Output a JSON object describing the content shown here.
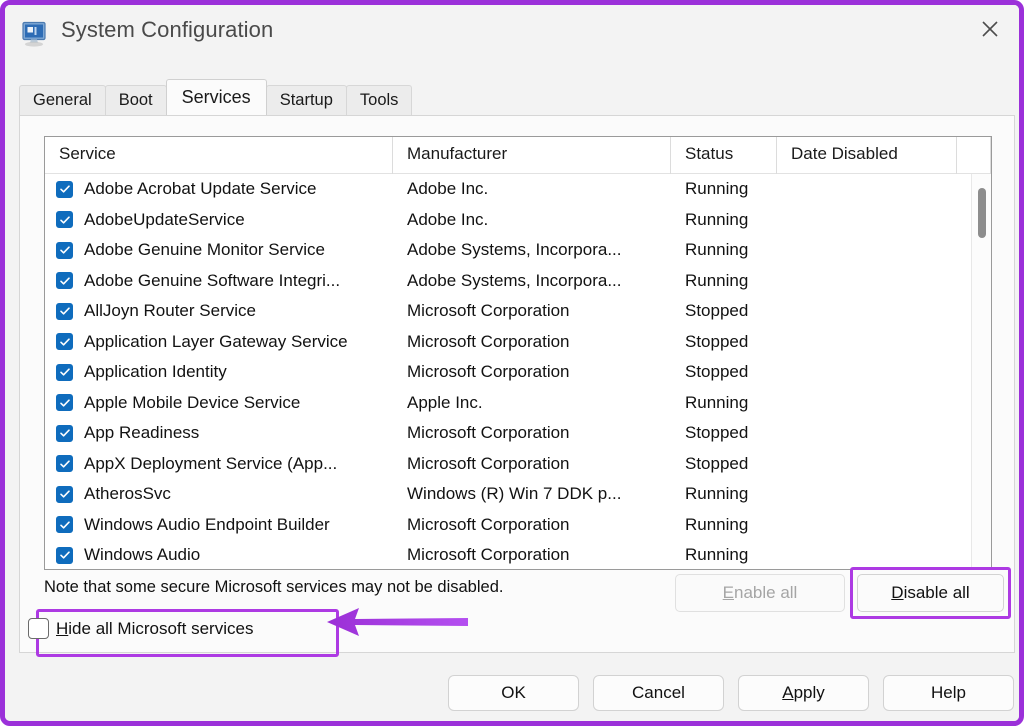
{
  "window": {
    "title": "System Configuration",
    "icon": "system-configuration-icon",
    "close_label": "✕",
    "accent_purple": "#ad3ae3",
    "border_purple": "#9b30d9"
  },
  "tabs": [
    {
      "label": "General",
      "active": false
    },
    {
      "label": "Boot",
      "active": false
    },
    {
      "label": "Services",
      "active": true
    },
    {
      "label": "Startup",
      "active": false
    },
    {
      "label": "Tools",
      "active": false
    }
  ],
  "services_table": {
    "columns": [
      "Service",
      "Manufacturer",
      "Status",
      "Date Disabled"
    ],
    "rows": [
      {
        "checked": true,
        "service": "Adobe Acrobat Update Service",
        "manufacturer": "Adobe Inc.",
        "status": "Running",
        "date_disabled": ""
      },
      {
        "checked": true,
        "service": "AdobeUpdateService",
        "manufacturer": "Adobe Inc.",
        "status": "Running",
        "date_disabled": ""
      },
      {
        "checked": true,
        "service": "Adobe Genuine Monitor Service",
        "manufacturer": "Adobe Systems, Incorpora...",
        "status": "Running",
        "date_disabled": ""
      },
      {
        "checked": true,
        "service": "Adobe Genuine Software Integri...",
        "manufacturer": "Adobe Systems, Incorpora...",
        "status": "Running",
        "date_disabled": ""
      },
      {
        "checked": true,
        "service": "AllJoyn Router Service",
        "manufacturer": "Microsoft Corporation",
        "status": "Stopped",
        "date_disabled": ""
      },
      {
        "checked": true,
        "service": "Application Layer Gateway Service",
        "manufacturer": "Microsoft Corporation",
        "status": "Stopped",
        "date_disabled": ""
      },
      {
        "checked": true,
        "service": "Application Identity",
        "manufacturer": "Microsoft Corporation",
        "status": "Stopped",
        "date_disabled": ""
      },
      {
        "checked": true,
        "service": "Apple Mobile Device Service",
        "manufacturer": "Apple Inc.",
        "status": "Running",
        "date_disabled": ""
      },
      {
        "checked": true,
        "service": "App Readiness",
        "manufacturer": "Microsoft Corporation",
        "status": "Stopped",
        "date_disabled": ""
      },
      {
        "checked": true,
        "service": "AppX Deployment Service (App...",
        "manufacturer": "Microsoft Corporation",
        "status": "Stopped",
        "date_disabled": ""
      },
      {
        "checked": true,
        "service": "AtherosSvc",
        "manufacturer": "Windows (R) Win 7 DDK p...",
        "status": "Running",
        "date_disabled": ""
      },
      {
        "checked": true,
        "service": "Windows Audio Endpoint Builder",
        "manufacturer": "Microsoft Corporation",
        "status": "Running",
        "date_disabled": ""
      },
      {
        "checked": true,
        "service": "Windows Audio",
        "manufacturer": "Microsoft Corporation",
        "status": "Running",
        "date_disabled": ""
      }
    ]
  },
  "note": "Note that some secure Microsoft services may not be disabled.",
  "hide_all_microsoft": {
    "label_prefix": "H",
    "label_rest": "ide all Microsoft services",
    "checked": false
  },
  "actions": {
    "enable_all": {
      "prefix": "E",
      "rest": "nable all",
      "disabled": true
    },
    "disable_all": {
      "prefix": "D",
      "rest": "isable all",
      "disabled": false
    }
  },
  "footer": {
    "ok": {
      "prefix": "",
      "rest": "OK"
    },
    "cancel": {
      "prefix": "",
      "rest": "Cancel"
    },
    "apply": {
      "prefix": "A",
      "rest": "pply"
    },
    "help": {
      "prefix": "",
      "rest": "Help"
    }
  },
  "annotations": {
    "arrow": "left-pointing-arrow",
    "highlights": [
      "hide-all-microsoft-services",
      "disable-all-button"
    ]
  }
}
